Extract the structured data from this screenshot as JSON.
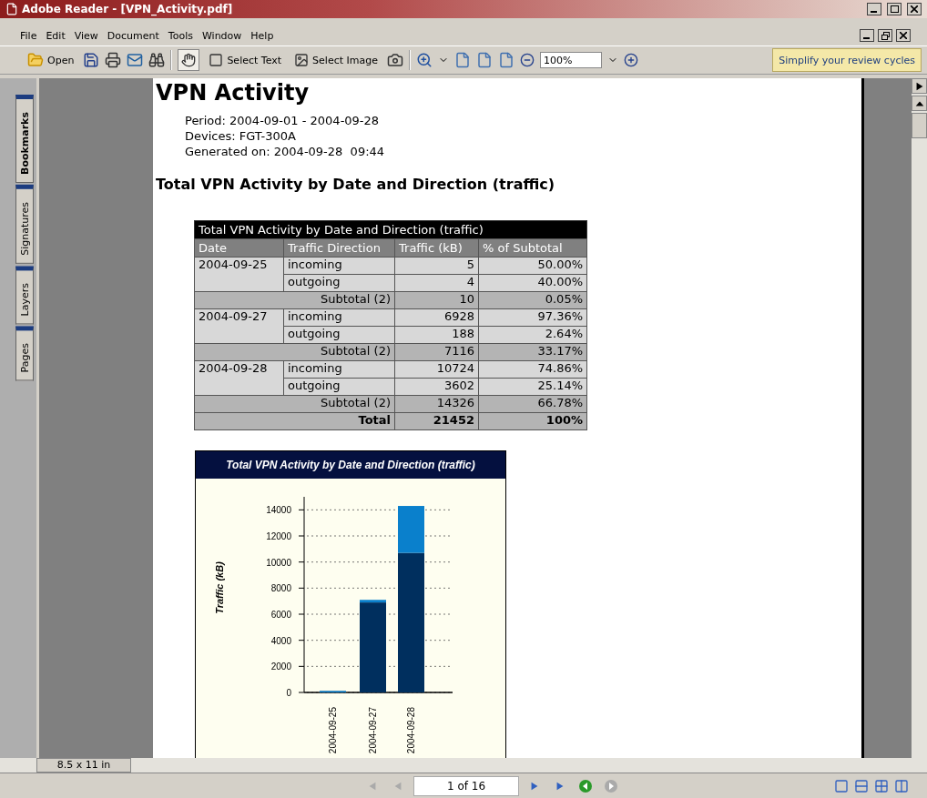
{
  "window": {
    "title": "Adobe Reader - [VPN_Activity.pdf]"
  },
  "menu": [
    "File",
    "Edit",
    "View",
    "Document",
    "Tools",
    "Window",
    "Help"
  ],
  "toolbar": {
    "open_label": "Open",
    "tools": [
      {
        "kind": "hand",
        "selected": true
      },
      {
        "kind": "select_text",
        "label": "Select Text",
        "selected": false
      },
      {
        "kind": "select_image",
        "label": "Select Image",
        "selected": false
      }
    ],
    "zoom_value": "100%",
    "promo": "Simplify your review cycles"
  },
  "side_tabs": [
    {
      "label": "Bookmarks",
      "selected": true
    },
    {
      "label": "Signatures",
      "selected": false
    },
    {
      "label": "Layers",
      "selected": false
    },
    {
      "label": "Pages",
      "selected": false
    }
  ],
  "document": {
    "title": "VPN Activity",
    "meta": [
      "Period: 2004-09-01 - 2004-09-28",
      "Devices: FGT-300A",
      "Generated on: 2004-09-28  09:44"
    ],
    "section_title": "Total VPN Activity by Date and Direction (traffic)",
    "table": {
      "title": "Total VPN Activity by Date and Direction (traffic)",
      "columns": [
        "Date",
        "Traffic Direction",
        "Traffic (kB)",
        "% of Subtotal"
      ],
      "groups": [
        {
          "date": "2004-09-25",
          "rows": [
            [
              "incoming",
              "5",
              "50.00%"
            ],
            [
              "outgoing",
              "4",
              "40.00%"
            ]
          ],
          "subtotal": [
            "Subtotal (2)",
            "10",
            "0.05%"
          ]
        },
        {
          "date": "2004-09-27",
          "rows": [
            [
              "incoming",
              "6928",
              "97.36%"
            ],
            [
              "outgoing",
              "188",
              "2.64%"
            ]
          ],
          "subtotal": [
            "Subtotal (2)",
            "7116",
            "33.17%"
          ]
        },
        {
          "date": "2004-09-28",
          "rows": [
            [
              "incoming",
              "10724",
              "74.86%"
            ],
            [
              "outgoing",
              "3602",
              "25.14%"
            ]
          ],
          "subtotal": [
            "Subtotal (2)",
            "14326",
            "66.78%"
          ]
        }
      ],
      "total": [
        "Total",
        "21452",
        "100%"
      ]
    },
    "chart": {
      "title": "Total VPN Activity by Date and Direction (traffic)",
      "chart_data": {
        "type": "bar",
        "stacked": true,
        "ylabel": "Traffic (kB)",
        "categories": [
          "2004-09-25",
          "2004-09-27",
          "2004-09-28"
        ],
        "series": [
          {
            "color": "#002f5e",
            "values": [
              0,
              6900,
              10700
            ]
          },
          {
            "color": "#0a80cc",
            "values": [
              0,
              200,
              3600
            ]
          }
        ],
        "ylim": [
          0,
          15000
        ],
        "grid": true,
        "yticks": [
          0,
          2000,
          4000,
          6000,
          8000,
          10000,
          12000,
          14000
        ]
      }
    }
  },
  "status": {
    "page_size": "8.5 x 11 in",
    "page_field": "1 of 16"
  }
}
